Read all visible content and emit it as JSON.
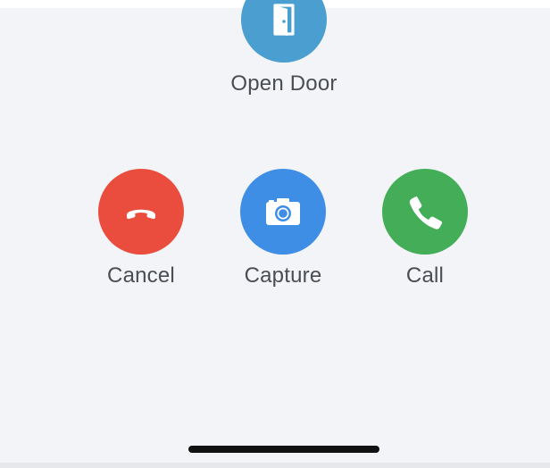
{
  "actions": {
    "open_door": {
      "label": "Open Door",
      "icon": "door-icon",
      "color": "#4a9fd0"
    },
    "cancel": {
      "label": "Cancel",
      "icon": "hang-up-phone-icon",
      "color": "#ea4d3d"
    },
    "capture": {
      "label": "Capture",
      "icon": "camera-icon",
      "color": "#3f8ee6"
    },
    "call": {
      "label": "Call",
      "icon": "phone-icon",
      "color": "#43ad57"
    }
  }
}
